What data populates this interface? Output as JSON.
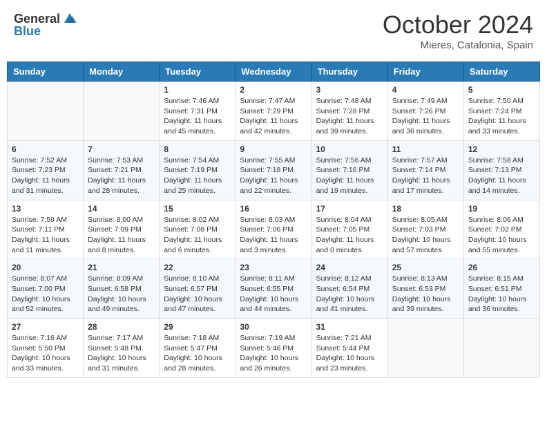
{
  "header": {
    "logo_general": "General",
    "logo_blue": "Blue",
    "month_title": "October 2024",
    "location": "Mieres, Catalonia, Spain"
  },
  "days_of_week": [
    "Sunday",
    "Monday",
    "Tuesday",
    "Wednesday",
    "Thursday",
    "Friday",
    "Saturday"
  ],
  "weeks": [
    [
      {
        "day": "",
        "sunrise": "",
        "sunset": "",
        "daylight": ""
      },
      {
        "day": "",
        "sunrise": "",
        "sunset": "",
        "daylight": ""
      },
      {
        "day": "1",
        "sunrise": "Sunrise: 7:46 AM",
        "sunset": "Sunset: 7:31 PM",
        "daylight": "Daylight: 11 hours and 45 minutes."
      },
      {
        "day": "2",
        "sunrise": "Sunrise: 7:47 AM",
        "sunset": "Sunset: 7:29 PM",
        "daylight": "Daylight: 11 hours and 42 minutes."
      },
      {
        "day": "3",
        "sunrise": "Sunrise: 7:48 AM",
        "sunset": "Sunset: 7:28 PM",
        "daylight": "Daylight: 11 hours and 39 minutes."
      },
      {
        "day": "4",
        "sunrise": "Sunrise: 7:49 AM",
        "sunset": "Sunset: 7:26 PM",
        "daylight": "Daylight: 11 hours and 36 minutes."
      },
      {
        "day": "5",
        "sunrise": "Sunrise: 7:50 AM",
        "sunset": "Sunset: 7:24 PM",
        "daylight": "Daylight: 11 hours and 33 minutes."
      }
    ],
    [
      {
        "day": "6",
        "sunrise": "Sunrise: 7:52 AM",
        "sunset": "Sunset: 7:23 PM",
        "daylight": "Daylight: 11 hours and 31 minutes."
      },
      {
        "day": "7",
        "sunrise": "Sunrise: 7:53 AM",
        "sunset": "Sunset: 7:21 PM",
        "daylight": "Daylight: 11 hours and 28 minutes."
      },
      {
        "day": "8",
        "sunrise": "Sunrise: 7:54 AM",
        "sunset": "Sunset: 7:19 PM",
        "daylight": "Daylight: 11 hours and 25 minutes."
      },
      {
        "day": "9",
        "sunrise": "Sunrise: 7:55 AM",
        "sunset": "Sunset: 7:18 PM",
        "daylight": "Daylight: 11 hours and 22 minutes."
      },
      {
        "day": "10",
        "sunrise": "Sunrise: 7:56 AM",
        "sunset": "Sunset: 7:16 PM",
        "daylight": "Daylight: 11 hours and 19 minutes."
      },
      {
        "day": "11",
        "sunrise": "Sunrise: 7:57 AM",
        "sunset": "Sunset: 7:14 PM",
        "daylight": "Daylight: 11 hours and 17 minutes."
      },
      {
        "day": "12",
        "sunrise": "Sunrise: 7:58 AM",
        "sunset": "Sunset: 7:13 PM",
        "daylight": "Daylight: 11 hours and 14 minutes."
      }
    ],
    [
      {
        "day": "13",
        "sunrise": "Sunrise: 7:59 AM",
        "sunset": "Sunset: 7:11 PM",
        "daylight": "Daylight: 11 hours and 11 minutes."
      },
      {
        "day": "14",
        "sunrise": "Sunrise: 8:00 AM",
        "sunset": "Sunset: 7:09 PM",
        "daylight": "Daylight: 11 hours and 8 minutes."
      },
      {
        "day": "15",
        "sunrise": "Sunrise: 8:02 AM",
        "sunset": "Sunset: 7:08 PM",
        "daylight": "Daylight: 11 hours and 6 minutes."
      },
      {
        "day": "16",
        "sunrise": "Sunrise: 8:03 AM",
        "sunset": "Sunset: 7:06 PM",
        "daylight": "Daylight: 11 hours and 3 minutes."
      },
      {
        "day": "17",
        "sunrise": "Sunrise: 8:04 AM",
        "sunset": "Sunset: 7:05 PM",
        "daylight": "Daylight: 11 hours and 0 minutes."
      },
      {
        "day": "18",
        "sunrise": "Sunrise: 8:05 AM",
        "sunset": "Sunset: 7:03 PM",
        "daylight": "Daylight: 10 hours and 57 minutes."
      },
      {
        "day": "19",
        "sunrise": "Sunrise: 8:06 AM",
        "sunset": "Sunset: 7:02 PM",
        "daylight": "Daylight: 10 hours and 55 minutes."
      }
    ],
    [
      {
        "day": "20",
        "sunrise": "Sunrise: 8:07 AM",
        "sunset": "Sunset: 7:00 PM",
        "daylight": "Daylight: 10 hours and 52 minutes."
      },
      {
        "day": "21",
        "sunrise": "Sunrise: 8:09 AM",
        "sunset": "Sunset: 6:58 PM",
        "daylight": "Daylight: 10 hours and 49 minutes."
      },
      {
        "day": "22",
        "sunrise": "Sunrise: 8:10 AM",
        "sunset": "Sunset: 6:57 PM",
        "daylight": "Daylight: 10 hours and 47 minutes."
      },
      {
        "day": "23",
        "sunrise": "Sunrise: 8:11 AM",
        "sunset": "Sunset: 6:55 PM",
        "daylight": "Daylight: 10 hours and 44 minutes."
      },
      {
        "day": "24",
        "sunrise": "Sunrise: 8:12 AM",
        "sunset": "Sunset: 6:54 PM",
        "daylight": "Daylight: 10 hours and 41 minutes."
      },
      {
        "day": "25",
        "sunrise": "Sunrise: 8:13 AM",
        "sunset": "Sunset: 6:53 PM",
        "daylight": "Daylight: 10 hours and 39 minutes."
      },
      {
        "day": "26",
        "sunrise": "Sunrise: 8:15 AM",
        "sunset": "Sunset: 6:51 PM",
        "daylight": "Daylight: 10 hours and 36 minutes."
      }
    ],
    [
      {
        "day": "27",
        "sunrise": "Sunrise: 7:16 AM",
        "sunset": "Sunset: 5:50 PM",
        "daylight": "Daylight: 10 hours and 33 minutes."
      },
      {
        "day": "28",
        "sunrise": "Sunrise: 7:17 AM",
        "sunset": "Sunset: 5:48 PM",
        "daylight": "Daylight: 10 hours and 31 minutes."
      },
      {
        "day": "29",
        "sunrise": "Sunrise: 7:18 AM",
        "sunset": "Sunset: 5:47 PM",
        "daylight": "Daylight: 10 hours and 28 minutes."
      },
      {
        "day": "30",
        "sunrise": "Sunrise: 7:19 AM",
        "sunset": "Sunset: 5:46 PM",
        "daylight": "Daylight: 10 hours and 26 minutes."
      },
      {
        "day": "31",
        "sunrise": "Sunrise: 7:21 AM",
        "sunset": "Sunset: 5:44 PM",
        "daylight": "Daylight: 10 hours and 23 minutes."
      },
      {
        "day": "",
        "sunrise": "",
        "sunset": "",
        "daylight": ""
      },
      {
        "day": "",
        "sunrise": "",
        "sunset": "",
        "daylight": ""
      }
    ]
  ]
}
